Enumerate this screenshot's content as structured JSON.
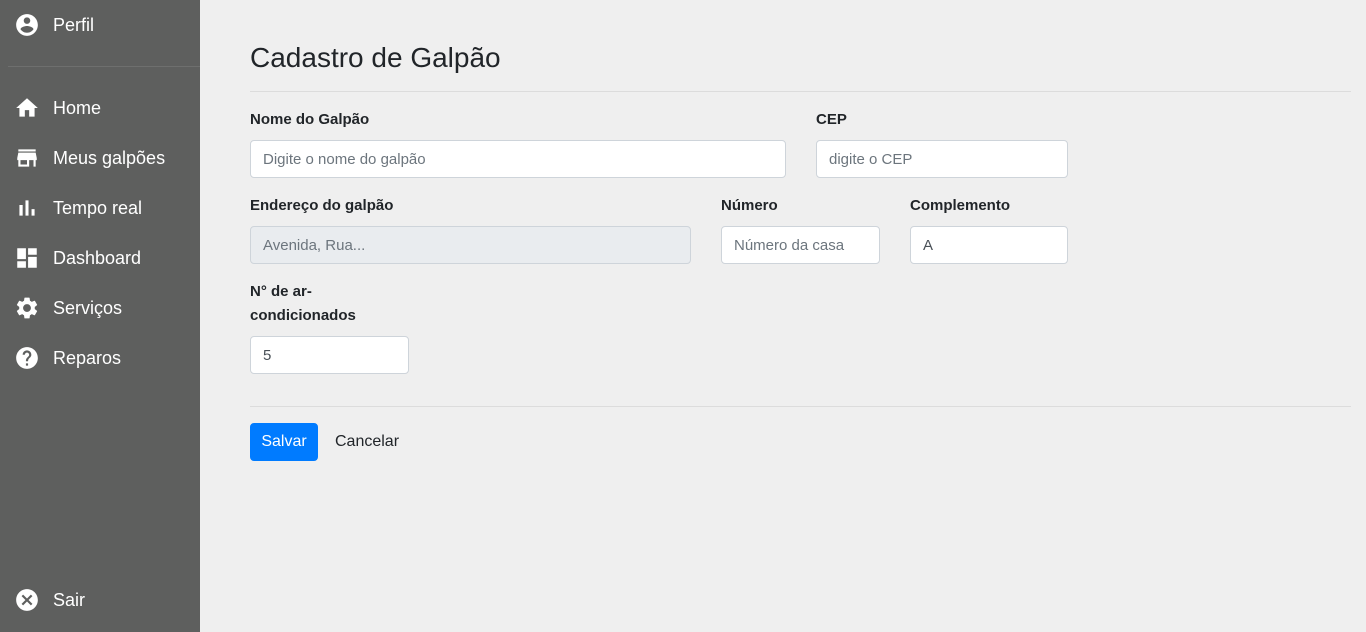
{
  "sidebar": {
    "profile": {
      "label": "Perfil",
      "icon": "account-circle-icon"
    },
    "items": [
      {
        "label": "Home",
        "icon": "home-icon"
      },
      {
        "label": "Meus galpões",
        "icon": "store-icon"
      },
      {
        "label": "Tempo real",
        "icon": "bar-chart-icon"
      },
      {
        "label": "Dashboard",
        "icon": "dashboard-icon"
      },
      {
        "label": "Serviços",
        "icon": "gear-icon"
      },
      {
        "label": "Reparos",
        "icon": "help-circle-icon"
      }
    ],
    "logout": {
      "label": "Sair",
      "icon": "close-circle-icon"
    },
    "background": "#5e5f5e"
  },
  "page": {
    "title": "Cadastro de Galpão"
  },
  "form": {
    "nome": {
      "label": "Nome do Galpão",
      "placeholder": "Digite o nome do galpão",
      "value": ""
    },
    "cep": {
      "label": "CEP",
      "placeholder": "digite o CEP",
      "value": ""
    },
    "endereco": {
      "label": "Endereço do galpão",
      "placeholder": "Avenida, Rua...",
      "value": ""
    },
    "numero": {
      "label": "Número",
      "placeholder": "Número da casa",
      "value": ""
    },
    "complemento": {
      "label": "Complemento",
      "placeholder": "",
      "value": "A"
    },
    "ar": {
      "label_line1": "N° de ar-",
      "label_line2": "condicionados",
      "placeholder": "",
      "value": "5"
    }
  },
  "actions": {
    "save_label": "Salvar",
    "cancel_label": "Cancelar",
    "primary_color": "#007bff"
  }
}
